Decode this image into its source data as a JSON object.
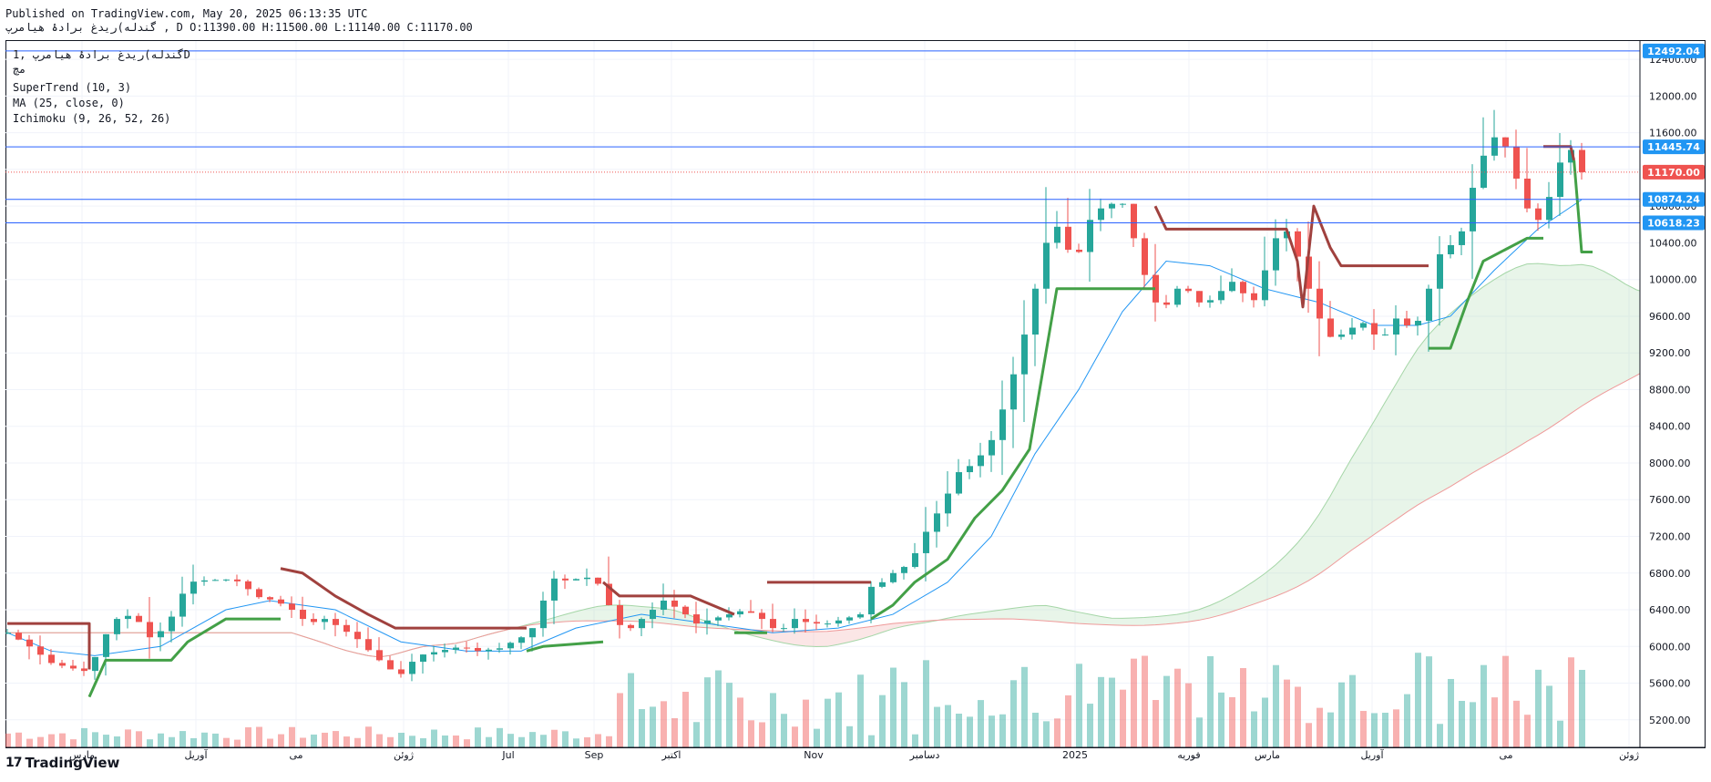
{
  "header": {
    "published": "Published on TradingView.com, May 20, 2025 06:13:35 UTC",
    "ohlc": "گندله)ریدغ برادۀ هیامرپ , D O:11390.00 H:11500.00 L:11140.00 C:11170.00"
  },
  "legend": {
    "symbol": "گندله)ریدغ برادۀ هیامرپ ,1D",
    "exchange": "مچ",
    "supertrend": "SuperTrend (10, 3)",
    "ma": "MA (25, close, 0)",
    "ichimoku": "Ichimoku (9, 26, 52, 26)"
  },
  "brand": {
    "logo": "17",
    "name": "TradingView"
  },
  "colors": {
    "up": "#26a69a",
    "down": "#ef5350",
    "st_up": "#43a047",
    "st_down": "#a0413e",
    "ma": "#2196f3",
    "hline": "#2962ff",
    "cloud_up": "#a5d6a7",
    "cloud_down": "#ef9a9a"
  },
  "chart_data": {
    "type": "candlestick",
    "ylim": [
      4900,
      12600
    ],
    "y_ticks": [
      5200,
      5600,
      6000,
      6400,
      6800,
      7200,
      7600,
      8000,
      8400,
      8800,
      9200,
      9600,
      10000,
      10400,
      10800,
      11200,
      11600,
      12000,
      12400
    ],
    "y_tick_labels": [
      "5200.00",
      "5600.00",
      "6000.00",
      "6400.00",
      "6800.00",
      "7200.00",
      "7600.00",
      "8000.00",
      "8400.00",
      "8800.00",
      "9200.00",
      "9600.00",
      "10000.00",
      "10400.00",
      "10800.00",
      "11200.00",
      "11600.00",
      "12000.00",
      "12400.00"
    ],
    "x_labels": [
      "مارس",
      "آوریل",
      "می",
      "ژوئن",
      "Jul",
      "Sep",
      "اکتبر",
      "Nov",
      "دسامبر",
      "2025",
      "فوریه",
      "مارس",
      "آوریل",
      "می",
      "ژوئن"
    ],
    "price_labels": [
      {
        "value": 12492.04,
        "text": "12492.04",
        "color": "#2196f3"
      },
      {
        "value": 11445.74,
        "text": "11445.74",
        "color": "#2196f3"
      },
      {
        "value": 11170.0,
        "text": "11170.00",
        "color": "#ef5350"
      },
      {
        "value": 10874.24,
        "text": "10874.24",
        "color": "#2196f3"
      },
      {
        "value": 10618.23,
        "text": "10618.23",
        "color": "#2196f3"
      }
    ],
    "last_ohlc": {
      "open": 11390,
      "high": 11500,
      "low": 11140,
      "close": 11170
    },
    "close_series": [
      [
        0,
        6150
      ],
      [
        20,
        6000
      ],
      [
        40,
        5820
      ],
      [
        60,
        5760
      ],
      [
        75,
        5720
      ],
      [
        85,
        6050
      ],
      [
        100,
        6300
      ],
      [
        115,
        6350
      ],
      [
        130,
        6100
      ],
      [
        145,
        6200
      ],
      [
        155,
        6450
      ],
      [
        165,
        6700
      ],
      [
        180,
        6720
      ],
      [
        200,
        6730
      ],
      [
        215,
        6700
      ],
      [
        225,
        6550
      ],
      [
        245,
        6500
      ],
      [
        260,
        6400
      ],
      [
        275,
        6250
      ],
      [
        290,
        6300
      ],
      [
        305,
        6200
      ],
      [
        320,
        6080
      ],
      [
        335,
        5900
      ],
      [
        350,
        5750
      ],
      [
        360,
        5700
      ],
      [
        375,
        5900
      ],
      [
        395,
        5950
      ],
      [
        415,
        6000
      ],
      [
        430,
        5950
      ],
      [
        450,
        5980
      ],
      [
        470,
        6100
      ],
      [
        485,
        6250
      ],
      [
        495,
        6750
      ],
      [
        510,
        6720
      ],
      [
        530,
        6750
      ],
      [
        545,
        6650
      ],
      [
        555,
        6250
      ],
      [
        570,
        6200
      ],
      [
        585,
        6350
      ],
      [
        600,
        6500
      ],
      [
        615,
        6400
      ],
      [
        630,
        6250
      ],
      [
        645,
        6300
      ],
      [
        660,
        6350
      ],
      [
        675,
        6400
      ],
      [
        690,
        6300
      ],
      [
        705,
        6150
      ],
      [
        720,
        6300
      ],
      [
        735,
        6250
      ],
      [
        750,
        6250
      ],
      [
        765,
        6300
      ],
      [
        780,
        6350
      ],
      [
        790,
        6650
      ],
      [
        800,
        6700
      ],
      [
        810,
        6800
      ],
      [
        825,
        6900
      ],
      [
        840,
        7250
      ],
      [
        855,
        7550
      ],
      [
        870,
        7900
      ],
      [
        885,
        8000
      ],
      [
        900,
        8250
      ],
      [
        915,
        8750
      ],
      [
        930,
        9400
      ],
      [
        945,
        10150
      ],
      [
        955,
        10650
      ],
      [
        965,
        10500
      ],
      [
        975,
        10150
      ],
      [
        985,
        10450
      ],
      [
        995,
        10850
      ],
      [
        1005,
        10700
      ],
      [
        1015,
        10950
      ],
      [
        1025,
        10700
      ],
      [
        1035,
        10200
      ],
      [
        1045,
        9900
      ],
      [
        1055,
        9600
      ],
      [
        1065,
        9850
      ],
      [
        1075,
        9950
      ],
      [
        1085,
        9800
      ],
      [
        1095,
        9700
      ],
      [
        1105,
        9850
      ],
      [
        1115,
        9900
      ],
      [
        1125,
        10050
      ],
      [
        1135,
        9650
      ],
      [
        1145,
        9900
      ],
      [
        1155,
        10300
      ],
      [
        1165,
        10600
      ],
      [
        1175,
        10450
      ],
      [
        1185,
        10050
      ],
      [
        1195,
        9750
      ],
      [
        1205,
        9400
      ],
      [
        1215,
        9350
      ],
      [
        1225,
        9450
      ],
      [
        1235,
        9500
      ],
      [
        1245,
        9550
      ],
      [
        1255,
        9250
      ],
      [
        1265,
        9550
      ],
      [
        1275,
        9600
      ],
      [
        1285,
        9400
      ],
      [
        1295,
        9700
      ],
      [
        1305,
        10100
      ],
      [
        1315,
        10450
      ],
      [
        1325,
        10300
      ],
      [
        1335,
        10750
      ],
      [
        1345,
        11250
      ],
      [
        1355,
        11450
      ],
      [
        1365,
        11650
      ],
      [
        1375,
        11250
      ],
      [
        1385,
        10950
      ],
      [
        1395,
        10600
      ],
      [
        1405,
        10700
      ],
      [
        1415,
        11100
      ],
      [
        1425,
        11450
      ],
      [
        1433,
        11390
      ],
      [
        1440,
        11170
      ]
    ],
    "ma_series": [
      [
        0,
        6150
      ],
      [
        40,
        5950
      ],
      [
        80,
        5900
      ],
      [
        140,
        6000
      ],
      [
        200,
        6400
      ],
      [
        240,
        6500
      ],
      [
        300,
        6400
      ],
      [
        360,
        6050
      ],
      [
        420,
        5950
      ],
      [
        470,
        5950
      ],
      [
        520,
        6200
      ],
      [
        580,
        6350
      ],
      [
        640,
        6250
      ],
      [
        700,
        6150
      ],
      [
        760,
        6200
      ],
      [
        810,
        6350
      ],
      [
        860,
        6700
      ],
      [
        900,
        7200
      ],
      [
        940,
        8100
      ],
      [
        980,
        8800
      ],
      [
        1020,
        9650
      ],
      [
        1060,
        10200
      ],
      [
        1100,
        10150
      ],
      [
        1150,
        9900
      ],
      [
        1200,
        9750
      ],
      [
        1250,
        9500
      ],
      [
        1290,
        9500
      ],
      [
        1320,
        9600
      ],
      [
        1360,
        10100
      ],
      [
        1400,
        10550
      ],
      [
        1440,
        10870
      ]
    ],
    "supertrend": [
      {
        "trend": "down",
        "points": [
          [
            0,
            6250
          ],
          [
            75,
            6250
          ],
          [
            75,
            5750
          ]
        ]
      },
      {
        "trend": "up",
        "points": [
          [
            75,
            5450
          ],
          [
            90,
            5850
          ],
          [
            150,
            5850
          ],
          [
            165,
            6050
          ],
          [
            200,
            6300
          ],
          [
            250,
            6300
          ]
        ]
      },
      {
        "trend": "down",
        "points": [
          [
            250,
            6850
          ],
          [
            270,
            6800
          ],
          [
            300,
            6550
          ],
          [
            330,
            6350
          ],
          [
            355,
            6200
          ],
          [
            475,
            6200
          ]
        ]
      },
      {
        "trend": "up",
        "points": [
          [
            475,
            5950
          ],
          [
            490,
            6000
          ],
          [
            545,
            6050
          ]
        ]
      },
      {
        "trend": "down",
        "points": [
          [
            545,
            6700
          ],
          [
            560,
            6550
          ],
          [
            625,
            6550
          ],
          [
            665,
            6350
          ]
        ]
      },
      {
        "trend": "up",
        "points": [
          [
            665,
            6150
          ],
          [
            695,
            6150
          ]
        ]
      },
      {
        "trend": "down",
        "points": [
          [
            695,
            6700
          ],
          [
            790,
            6700
          ]
        ]
      },
      {
        "trend": "up",
        "points": [
          [
            790,
            6300
          ],
          [
            810,
            6450
          ],
          [
            830,
            6700
          ],
          [
            860,
            6950
          ],
          [
            885,
            7400
          ],
          [
            910,
            7700
          ],
          [
            935,
            8150
          ],
          [
            960,
            9900
          ],
          [
            1050,
            9900
          ]
        ]
      },
      {
        "trend": "down",
        "points": [
          [
            1050,
            10800
          ],
          [
            1060,
            10550
          ],
          [
            1170,
            10550
          ],
          [
            1180,
            10200
          ],
          [
            1185,
            9700
          ],
          [
            1195,
            10800
          ],
          [
            1210,
            10350
          ],
          [
            1220,
            10150
          ],
          [
            1300,
            10150
          ]
        ]
      },
      {
        "trend": "up",
        "points": [
          [
            1300,
            9250
          ],
          [
            1320,
            9250
          ],
          [
            1335,
            9750
          ],
          [
            1350,
            10200
          ],
          [
            1390,
            10450
          ],
          [
            1405,
            10450
          ]
        ]
      },
      {
        "trend": "down",
        "points": [
          [
            1405,
            11450
          ],
          [
            1430,
            11450
          ],
          [
            1433,
            11300
          ]
        ]
      },
      {
        "trend": "up",
        "points": [
          [
            1433,
            11300
          ],
          [
            1440,
            10300
          ],
          [
            1450,
            10300
          ]
        ]
      }
    ],
    "horizontal_lines": [
      12492.04,
      11445.74,
      10874.24,
      10618.23
    ],
    "volume_max": 6800,
    "volume_base": 4900
  }
}
